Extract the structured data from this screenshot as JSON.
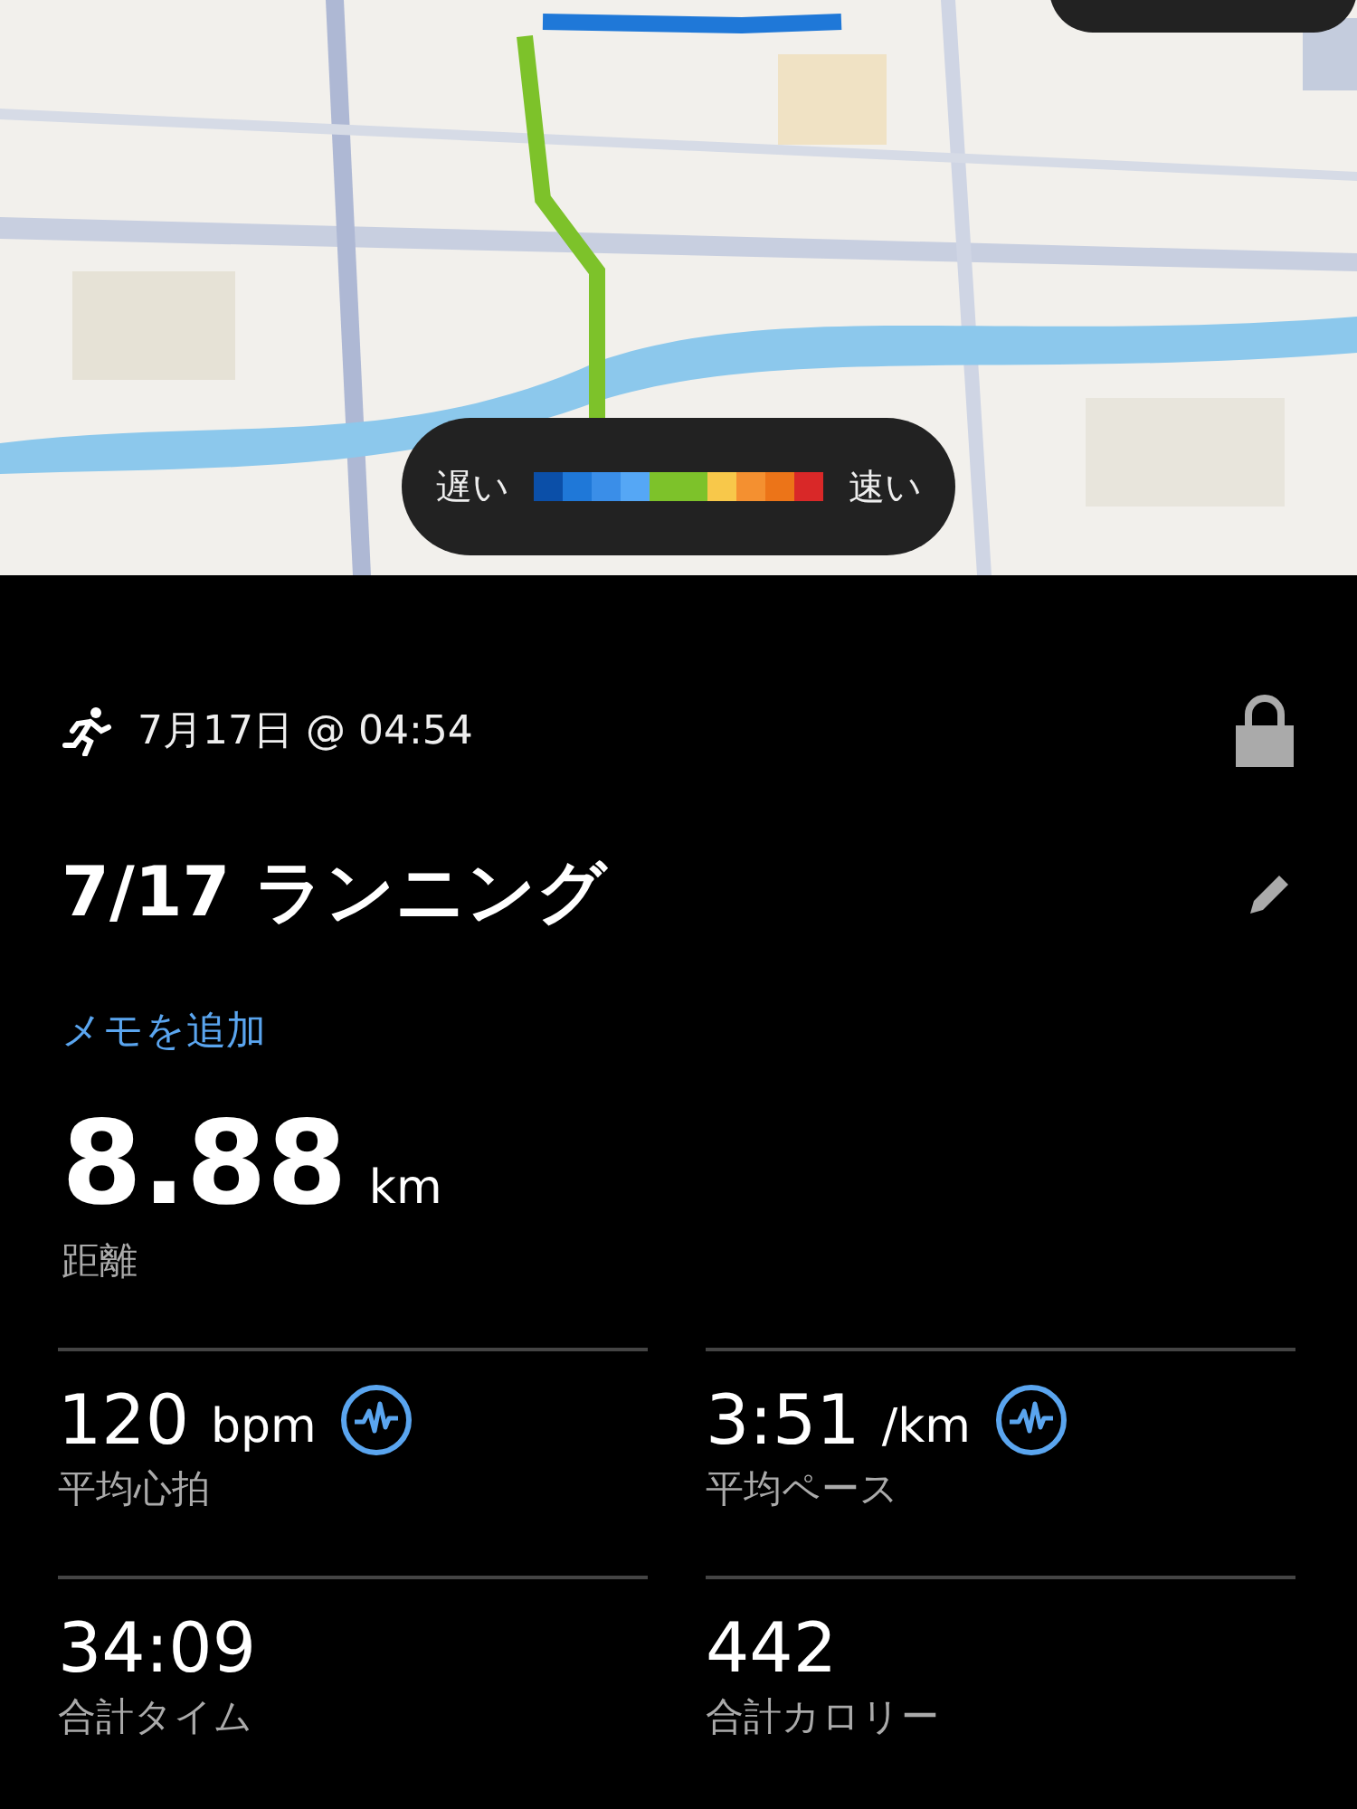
{
  "map": {
    "kind": "picture",
    "legend": {
      "slow_label": "遅い",
      "fast_label": "速い",
      "colors": [
        {
          "color": "#0b4fa8"
        },
        {
          "color": "#1f78d8"
        },
        {
          "color": "#3a8ee8"
        },
        {
          "color": "#55a7f5"
        },
        {
          "color": "#7dc22a"
        },
        {
          "color": "#7dc22a"
        },
        {
          "color": "#f8c84a"
        },
        {
          "color": "#f49030"
        },
        {
          "color": "#ec7418"
        },
        {
          "color": "#d92828"
        }
      ]
    }
  },
  "activity": {
    "date": "7月17日 @ 04:54",
    "locked": true,
    "title": "7/17 ランニング",
    "add_memo": "メモを追加"
  },
  "distance": {
    "value": "8.88",
    "unit": "km",
    "label": "距離"
  },
  "stats": [
    {
      "value": "120",
      "unit": "bpm",
      "label": "平均心拍",
      "chart_icon": true
    },
    {
      "value": "3:51",
      "unit": "/km",
      "label": "平均ペース",
      "chart_icon": true
    },
    {
      "value": "34:09",
      "label": "合計タイム",
      "chart_icon": false
    },
    {
      "value": "442",
      "label": "合計カロリー",
      "chart_icon": false
    }
  ]
}
